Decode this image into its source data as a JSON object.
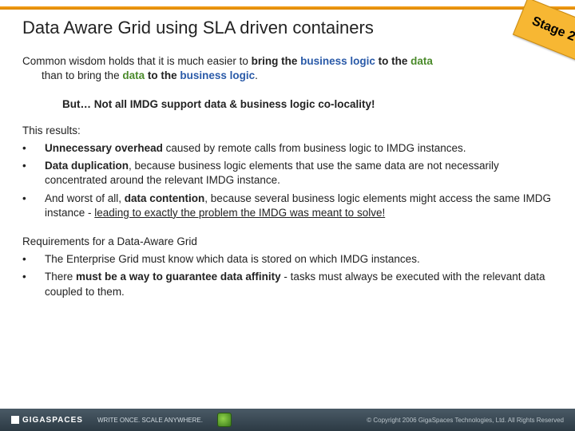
{
  "title": "Data Aware Grid using SLA driven containers",
  "stage_badge": "Stage 2",
  "para1_a": "Common wisdom holds that it is much easier to ",
  "para1_b": "bring the ",
  "para1_c": "business logic",
  "para1_d": " to the ",
  "para1_e": "data",
  "para1_f": " than to bring the ",
  "para1_g": "data",
  "para1_h": " to the ",
  "para1_i": "business logic",
  "para1_j": ".",
  "but_line": "But… Not all IMDG support data & business logic co-locality!",
  "results_intro": "This results:",
  "bullets1": [
    {
      "pre": "",
      "bold": "Unnecessary overhead",
      "post": " caused by remote calls from business logic to IMDG instances."
    },
    {
      "pre": "",
      "bold": "Data duplication",
      "post": ", because business logic elements that use the same data are not necessarily concentrated around the relevant IMDG instance."
    }
  ],
  "bullet1c_pre": "And worst of all, ",
  "bullet1c_bold": "data contention",
  "bullet1c_mid": ", because several business logic elements might access the same IMDG instance - ",
  "bullet1c_ul": "leading to exactly the problem the IMDG was meant to solve!",
  "req_title": "Requirements for a Data-Aware Grid",
  "req1": "The Enterprise Grid must know which data is stored on which IMDG instances.",
  "req2_a": "There ",
  "req2_b": "must be a way to guarantee data affinity",
  "req2_c": " - tasks must always be executed with the relevant data coupled to them.",
  "footer": {
    "brand": "GIGASPACES",
    "tagline": "WRITE ONCE. SCALE ANYWHERE.",
    "copyright": "© Copyright 2006 GigaSpaces Technologies, Ltd. All Rights Reserved"
  }
}
